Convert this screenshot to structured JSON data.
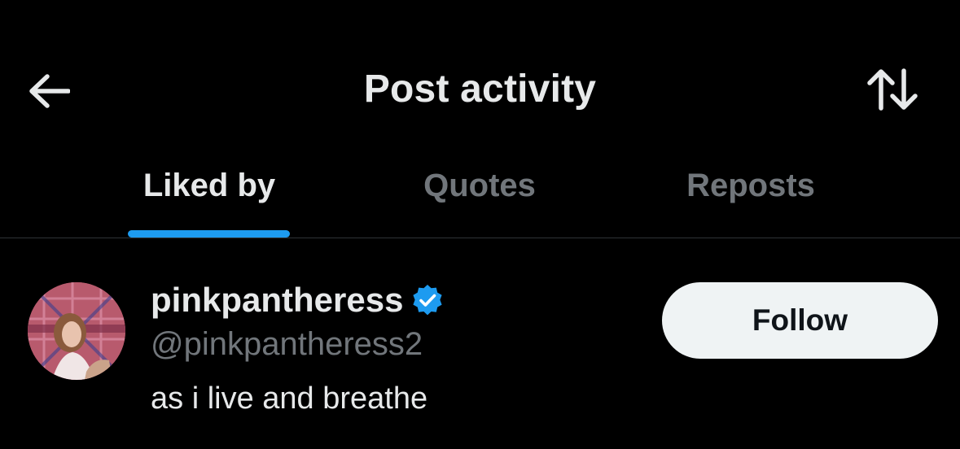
{
  "header": {
    "title": "Post activity",
    "back_icon": "arrow-left-icon",
    "sort_icon": "sort-arrows-icon"
  },
  "tabs": [
    {
      "label": "Liked by",
      "active": true
    },
    {
      "label": "Quotes",
      "active": false
    },
    {
      "label": "Reposts",
      "active": false
    }
  ],
  "user": {
    "display_name": "pinkpantheress",
    "handle": "@pinkpantheress2",
    "bio": "as i live and breathe",
    "verified": true,
    "follow_label": "Follow"
  },
  "colors": {
    "background": "#000000",
    "text_primary": "#e7e9ea",
    "text_secondary": "#71767b",
    "accent": "#1d9bf0",
    "follow_bg": "#eff3f4",
    "divider": "#2f3336"
  }
}
